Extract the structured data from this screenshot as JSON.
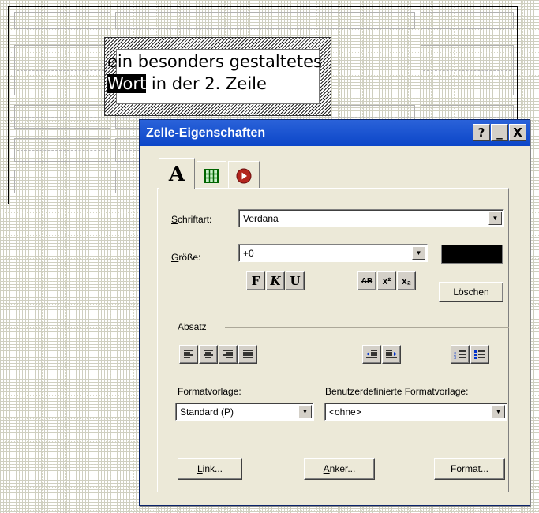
{
  "editor": {
    "cell_text_line1": "ein besonders gestaltetes",
    "cell_text_highlight": "Wort",
    "cell_text_line2_rest": " in der 2. Zeile"
  },
  "dialog": {
    "title": "Zelle-Eigenschaften",
    "title_buttons": {
      "help": "?",
      "minimize": "_",
      "close": "X"
    },
    "tabs": [
      {
        "name": "font-tab",
        "icon": "letter-a-icon",
        "glyph": "A"
      },
      {
        "name": "table-tab",
        "icon": "table-grid-icon"
      },
      {
        "name": "record-tab",
        "icon": "play-circle-icon"
      }
    ],
    "font": {
      "label": "Schriftart:",
      "label_rest": "chriftart:",
      "label_accel": "S",
      "value": "Verdana"
    },
    "size": {
      "label_accel": "G",
      "label_rest": "röße:",
      "value": "+0",
      "color": "#000000"
    },
    "style_buttons": {
      "bold": "F",
      "italic": "K",
      "underline": "U"
    },
    "effect_buttons": {
      "strike": "AB",
      "superscript": "x²",
      "subscript": "x₂"
    },
    "clear_button": "Löschen",
    "paragraph_group": "Absatz",
    "align_icons": [
      "align-left-icon",
      "align-center-icon",
      "align-right-icon",
      "justify-icon"
    ],
    "indent_icons": [
      "outdent-icon",
      "indent-icon"
    ],
    "list_icons": [
      "numbered-list-icon",
      "bullet-list-icon"
    ],
    "style_label": "Formatvorlage:",
    "style_value": "Standard (P)",
    "custom_style_label": "Benutzerdefinierte Formatvorlage:",
    "custom_style_value": "<ohne>",
    "buttons": {
      "link_accel": "L",
      "link_rest": "ink...",
      "anchor_accel": "A",
      "anchor_rest": "nker...",
      "format": "Format..."
    }
  }
}
